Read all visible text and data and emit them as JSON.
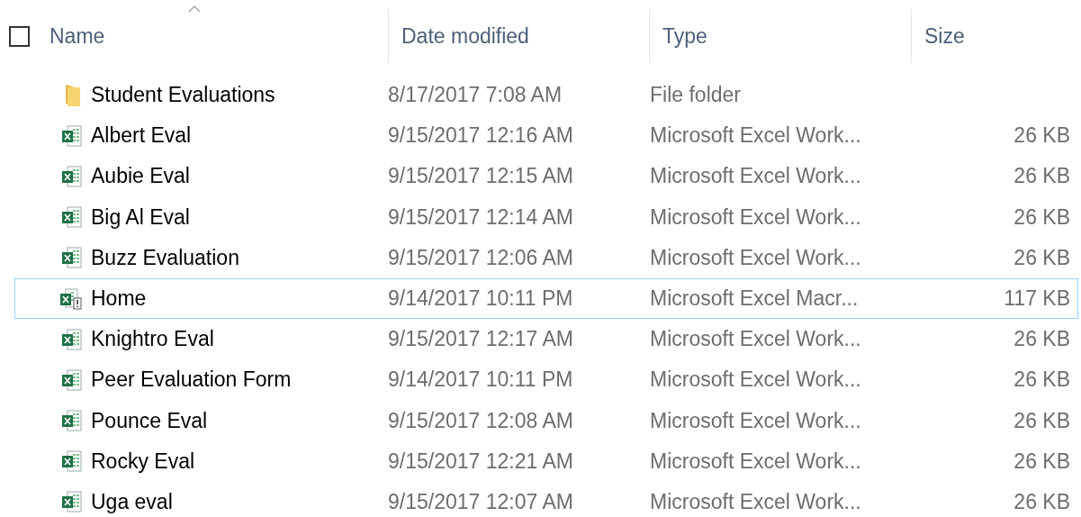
{
  "header": {
    "select_all_checked": false,
    "columns": [
      {
        "label": "Name",
        "sorted": true
      },
      {
        "label": "Date modified",
        "sorted": false
      },
      {
        "label": "Type",
        "sorted": false
      },
      {
        "label": "Size",
        "sorted": false
      }
    ]
  },
  "rows": [
    {
      "kind": "folder",
      "name": "Student Evaluations",
      "date": "8/17/2017 7:08 AM",
      "type": "File folder",
      "focused": false
    },
    {
      "kind": "excel",
      "name": "Albert Eval",
      "date": "9/15/2017 12:16 AM",
      "type": "Microsoft Excel Work...",
      "size": "26 KB",
      "focused": false
    },
    {
      "kind": "excel",
      "name": "Aubie Eval",
      "date": "9/15/2017 12:15 AM",
      "type": "Microsoft Excel Work...",
      "size": "26 KB",
      "focused": false
    },
    {
      "kind": "excel",
      "name": "Big Al Eval",
      "date": "9/15/2017 12:14 AM",
      "type": "Microsoft Excel Work...",
      "size": "26 KB",
      "focused": false
    },
    {
      "kind": "excel",
      "name": "Buzz Evaluation",
      "date": "9/15/2017 12:06 AM",
      "type": "Microsoft Excel Work...",
      "size": "26 KB",
      "focused": false
    },
    {
      "kind": "macro",
      "name": "Home",
      "date": "9/14/2017 10:11 PM",
      "type": "Microsoft Excel Macr...",
      "size": "117 KB",
      "focused": true
    },
    {
      "kind": "excel",
      "name": "Knightro Eval",
      "date": "9/15/2017 12:17 AM",
      "type": "Microsoft Excel Work...",
      "size": "26 KB",
      "focused": false
    },
    {
      "kind": "excel",
      "name": "Peer Evaluation Form",
      "date": "9/14/2017 10:11 PM",
      "type": "Microsoft Excel Work...",
      "size": "26 KB",
      "focused": false
    },
    {
      "kind": "excel",
      "name": "Pounce Eval",
      "date": "9/15/2017 12:08 AM",
      "type": "Microsoft Excel Work...",
      "size": "26 KB",
      "focused": false
    },
    {
      "kind": "excel",
      "name": "Rocky Eval",
      "date": "9/15/2017 12:21 AM",
      "type": "Microsoft Excel Work...",
      "size": "26 KB",
      "focused": false
    },
    {
      "kind": "excel",
      "name": "Uga eval",
      "date": "9/15/2017 12:07 AM",
      "type": "Microsoft Excel Work...",
      "size": "26 KB",
      "focused": false
    }
  ]
}
